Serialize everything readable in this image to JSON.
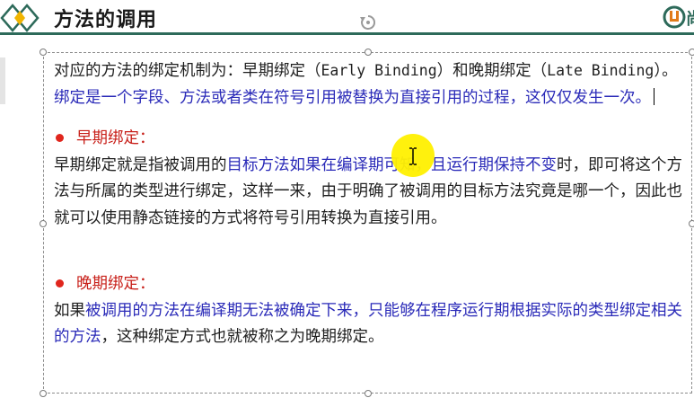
{
  "header": {
    "title": "方法的调用",
    "logo_left_icon": "double-diamond-logo-icon",
    "brand_logo_icon": "brand-u-logo-icon",
    "brand_logo_text": "尚",
    "rule_color": "#2d6a5a"
  },
  "textbox": {
    "intro": {
      "seg1": "对应的方法的绑定机制为：早期绑定（",
      "seg2": "Early Binding",
      "seg3": "）和晚期绑定（",
      "seg4": "Late Binding",
      "seg5": "）。",
      "seg6": "绑定是一个字段、方法或者类在符号引用被替换为直接引用的过程，这仅仅发生一次。"
    },
    "early": {
      "heading": "早期绑定：",
      "seg1": "早期绑定就是指被调用的",
      "seg2": "目标方法如果在编译期可知，且运行期保持不变",
      "seg3": "时，即可将这个方法与所属的类型进行绑定，这样一来，由于明确了被调用的目标方法究竟是哪一个，因此也就可以使用静态链接的方式将符号引用转换为直接引用。"
    },
    "late": {
      "heading": "晚期绑定：",
      "seg1": "如果",
      "seg2": "被调用的方法在编译期无法被确定下来，只能够在程序运行期根据实际的类型绑定相关的方法",
      "seg3": "，这种绑定方式也就被称之为晚期绑定。"
    }
  },
  "colors": {
    "blue_text": "#2a2ab8",
    "red_heading": "#c8201a",
    "bullet": "#e0261d",
    "cursor_highlight": "#fff000"
  },
  "icons": {
    "rotate_handle": "rotate-handle-icon",
    "text_cursor": "ibeam-cursor-icon",
    "bullet": "bullet-dot-icon"
  }
}
